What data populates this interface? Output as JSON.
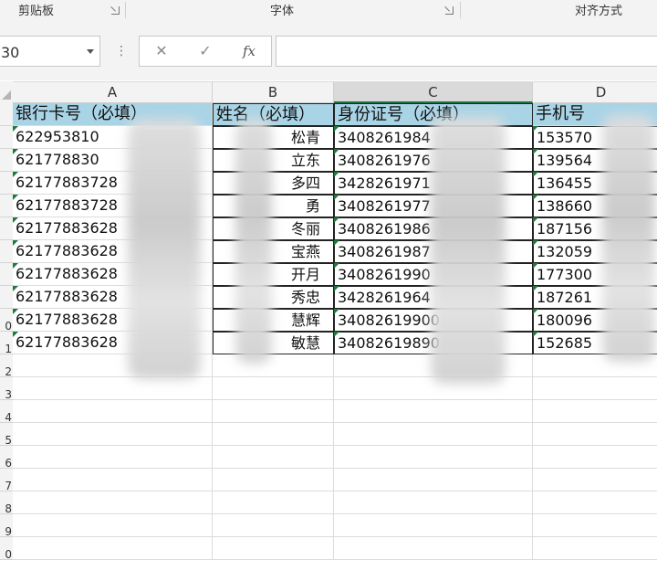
{
  "ribbon": {
    "groups": [
      "剪贴板",
      "字体",
      "对齐方式"
    ]
  },
  "formula_bar": {
    "name_box": "30",
    "cancel_glyph": "✕",
    "enter_glyph": "✓",
    "fx_label": "fx",
    "formula_value": ""
  },
  "sheet": {
    "columns": [
      "A",
      "B",
      "C",
      "D"
    ],
    "selected_column": "C",
    "row_numbers": [
      "",
      "",
      "",
      "",
      "",
      "",
      "",
      "",
      "",
      "0",
      "1",
      "2",
      "3",
      "4",
      "5",
      "6",
      "7",
      "8",
      "9",
      "0"
    ],
    "header_row": [
      "银行卡号（必填）",
      "姓名（必填）",
      "身份证号（必填）",
      "手机号"
    ],
    "rows": [
      {
        "a": "622953810",
        "b": "松青",
        "c": "3408261984",
        "d": "153570"
      },
      {
        "a": "621778830",
        "b": "立东",
        "c": "3408261976",
        "d": "139564"
      },
      {
        "a": "62177883728",
        "b": "多四",
        "c": "3428261971",
        "d": "136455"
      },
      {
        "a": "62177883728",
        "b": "勇",
        "c": "3408261977",
        "d": "138660"
      },
      {
        "a": "62177883628",
        "b": "冬丽",
        "c": "3408261986",
        "d": "187156"
      },
      {
        "a": "62177883628",
        "b": "宝燕",
        "c": "3408261987",
        "d": "132059"
      },
      {
        "a": "62177883628",
        "b": "开月",
        "c": "3408261990",
        "d": "177300"
      },
      {
        "a": "62177883628",
        "b": "秀忠",
        "c": "3428261964",
        "d": "187261"
      },
      {
        "a": "62177883628",
        "b": "慧辉",
        "c": "34082619900",
        "d": "180096"
      },
      {
        "a": "62177883628",
        "b": "敏慧",
        "c": "34082619890",
        "d": "152685"
      }
    ]
  }
}
